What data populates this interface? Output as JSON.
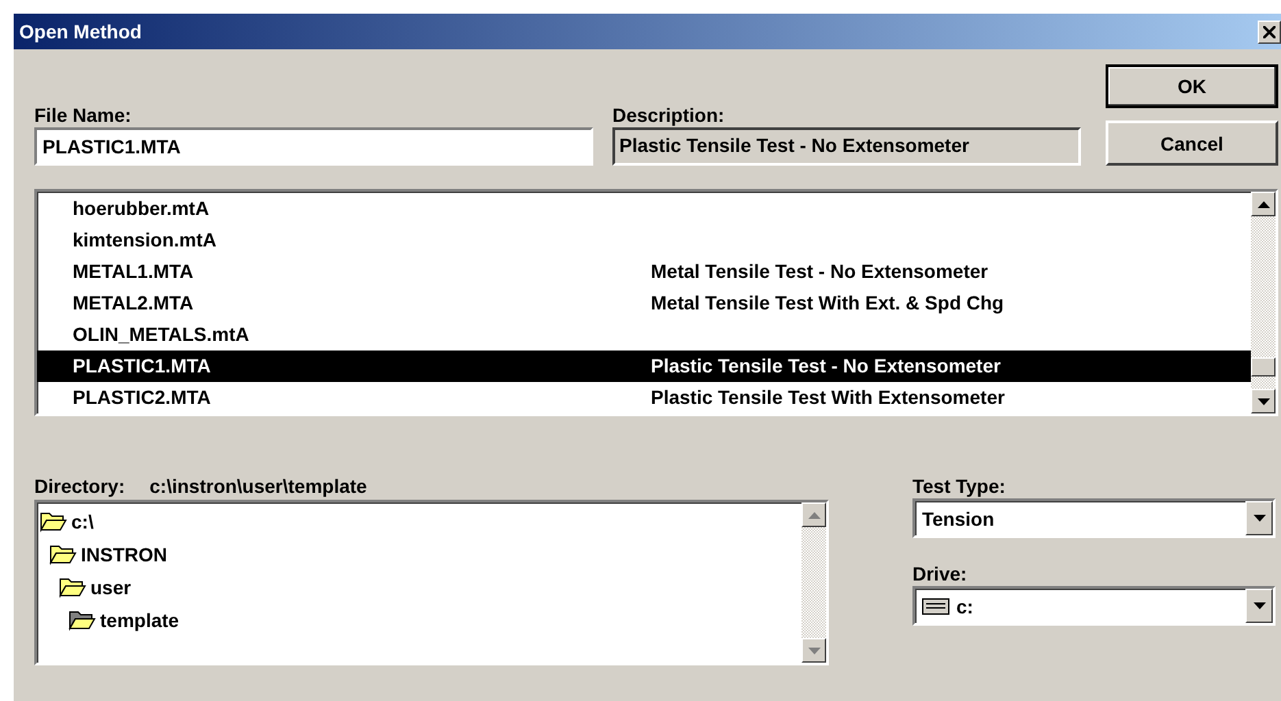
{
  "window": {
    "title": "Open Method"
  },
  "file_name": {
    "label": "File Name:",
    "value": "PLASTIC1.MTA"
  },
  "description": {
    "label": "Description:",
    "value": "Plastic Tensile Test - No Extensometer"
  },
  "buttons": [
    "OK",
    "Cancel"
  ],
  "method_list": [
    {
      "name": "hoerubber.mtA",
      "selected": false
    },
    {
      "name": "kimtension.mtA",
      "selected": false
    },
    {
      "name": "METAL1.MTA",
      "description": "Metal Tensile Test - No Extensometer",
      "selected": false
    },
    {
      "name": "METAL2.MTA",
      "description": "Metal Tensile Test With Ext. & Spd Chg",
      "selected": false
    },
    {
      "name": "OLIN_METALS.mtA",
      "selected": false
    },
    {
      "name": "PLASTIC1.MTA",
      "description": "Plastic Tensile Test - No Extensometer",
      "selected": true
    },
    {
      "name": "PLASTIC2.MTA",
      "description": "Plastic Tensile Test With Extensometer",
      "selected": false
    }
  ],
  "directory": {
    "label": "Directory:",
    "path": "c:\\instron\\user\\template",
    "tree": [
      {
        "label": "c:\\",
        "selected": false,
        "children": [
          {
            "label": "INSTRON",
            "selected": false,
            "children": [
              {
                "label": "user",
                "selected": false,
                "children": [
                  {
                    "label": "template",
                    "selected": true
                  }
                ]
              }
            ]
          }
        ]
      }
    ]
  },
  "test_type": {
    "label": "Test Type:",
    "value": "Tension"
  },
  "drive": {
    "label": "Drive:",
    "value": "c:"
  }
}
